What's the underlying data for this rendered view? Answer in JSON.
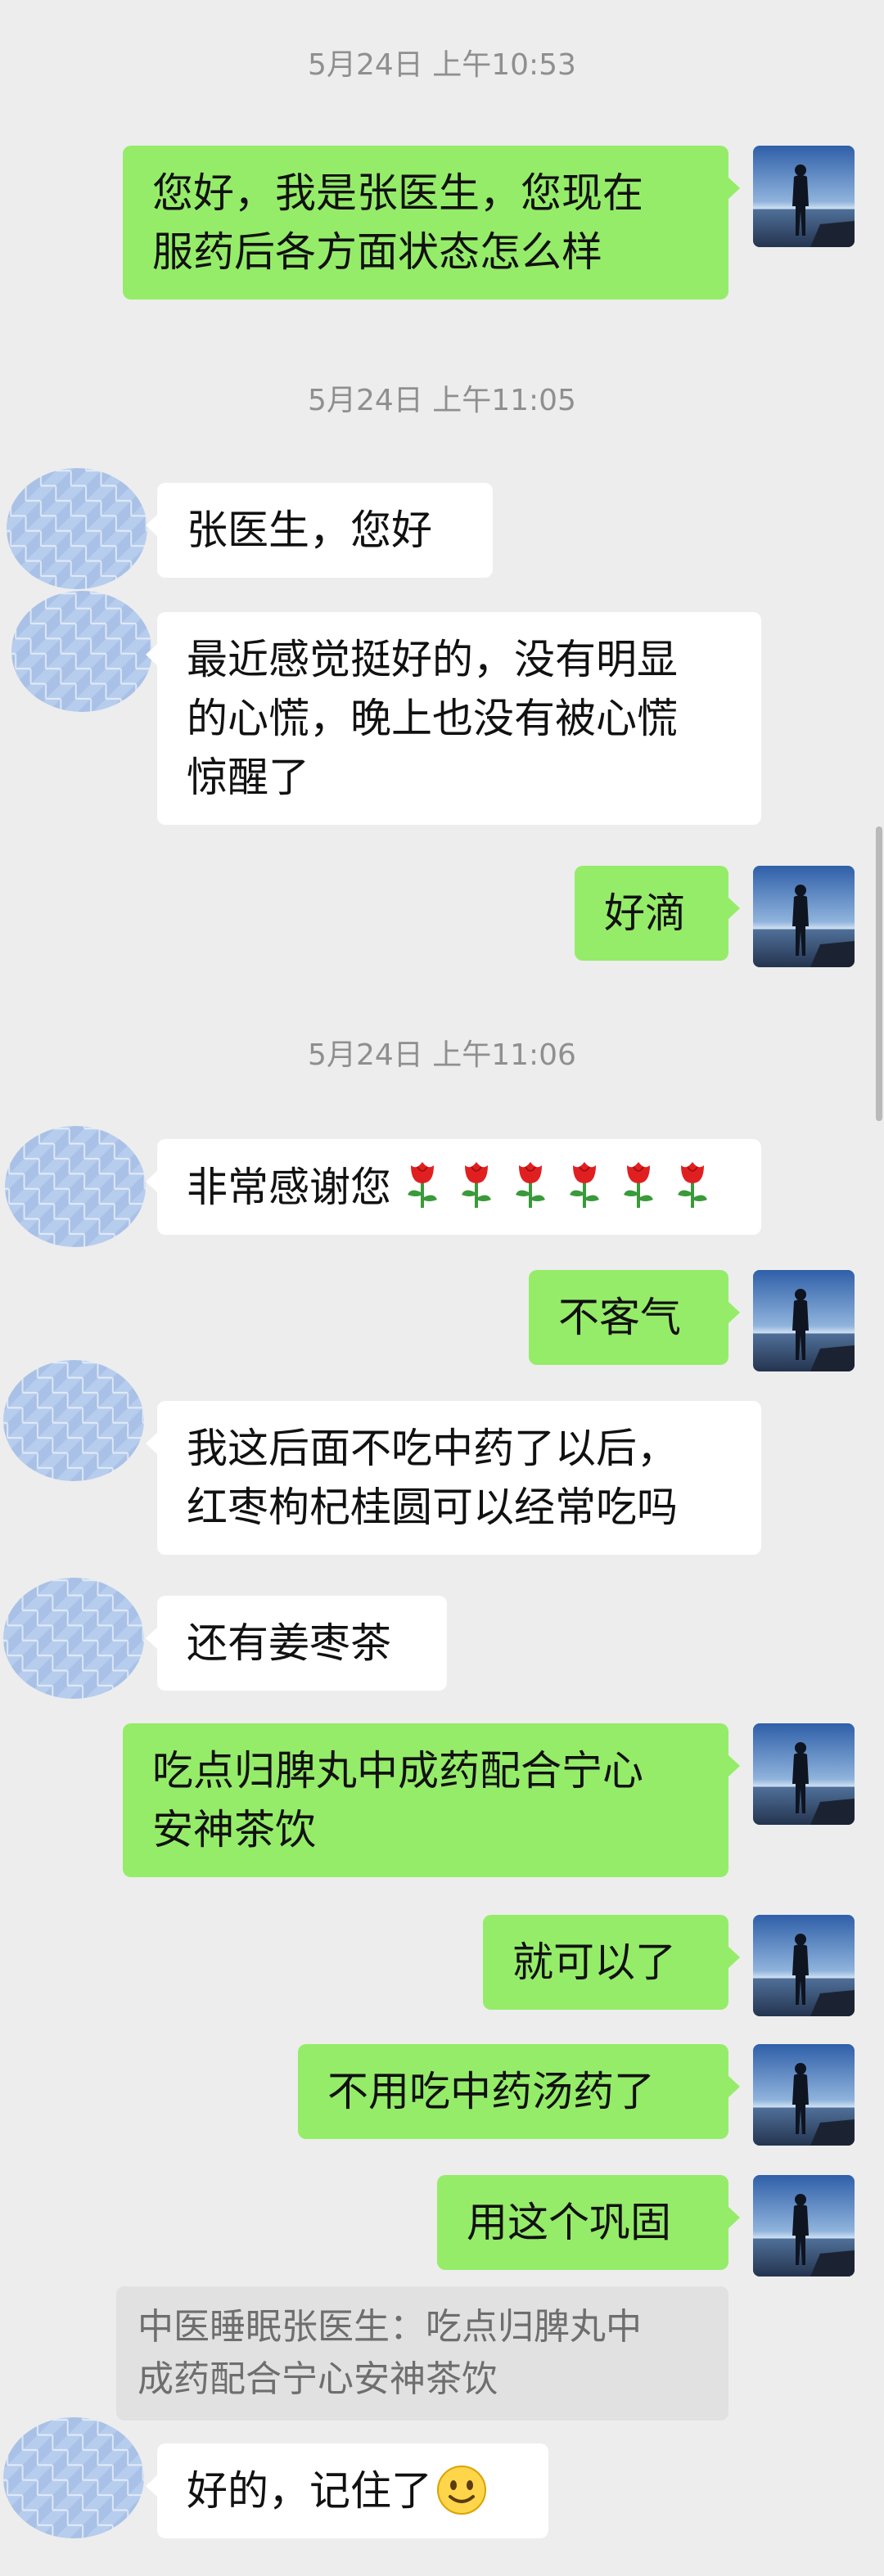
{
  "timestamps": [
    "5月24日 上午10:53",
    "5月24日 上午11:05",
    "5月24日 上午11:06"
  ],
  "messages": {
    "m1": "您好，我是张医生，您现在\n服药后各方面状态怎么样",
    "m2": "张医生，您好",
    "m3": "最近感觉挺好的，没有明显\n的心慌，晚上也没有被心慌\n惊醒了",
    "m4": "好滴",
    "m5": "非常感谢您",
    "m6": "不客气",
    "m7": "我这后面不吃中药了以后，\n红枣枸杞桂圆可以经常吃吗",
    "m8": "还有姜枣茶",
    "m9": "吃点归脾丸中成药配合宁心\n安神茶饮",
    "m10": "就可以了",
    "m11": "不用吃中药汤药了",
    "m12": "用这个巩固",
    "quote": "中医睡眠张医生：吃点归脾丸中\n成药配合宁心安神茶饮",
    "m13": "好的，记住了"
  },
  "icons": {
    "rose": "rose-emoji",
    "smile": "slightly-smiling-face-emoji",
    "avatar_me": "silhouette-by-sea-avatar",
    "avatar_them": "blurred-avatar"
  },
  "colors": {
    "background": "#ededed",
    "bubble_me": "#95ec69",
    "bubble_them": "#ffffff",
    "timestamp": "#8f8f8f"
  }
}
